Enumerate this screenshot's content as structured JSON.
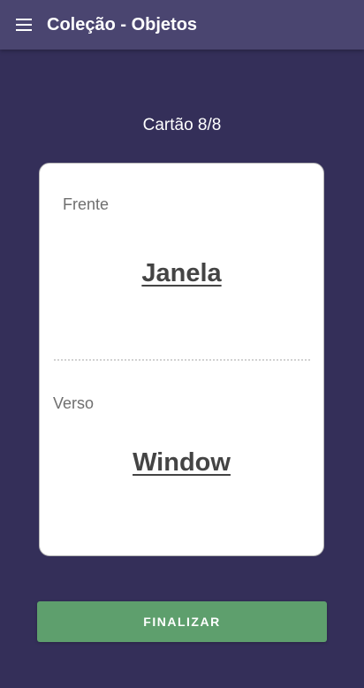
{
  "app_bar": {
    "menu_icon": "menu-icon",
    "title": "Coleção - Objetos"
  },
  "progress": {
    "label": "Cartão 8/8",
    "current": 8,
    "total": 8
  },
  "card": {
    "front_label": "Frente",
    "front_word": "Janela",
    "back_label": "Verso",
    "back_word": "Window"
  },
  "actions": {
    "finish_label": "FINALIZAR"
  },
  "colors": {
    "background": "#342f59",
    "app_bar": "#4a4570",
    "card": "#ffffff",
    "finish_button": "#5e9f6d"
  }
}
